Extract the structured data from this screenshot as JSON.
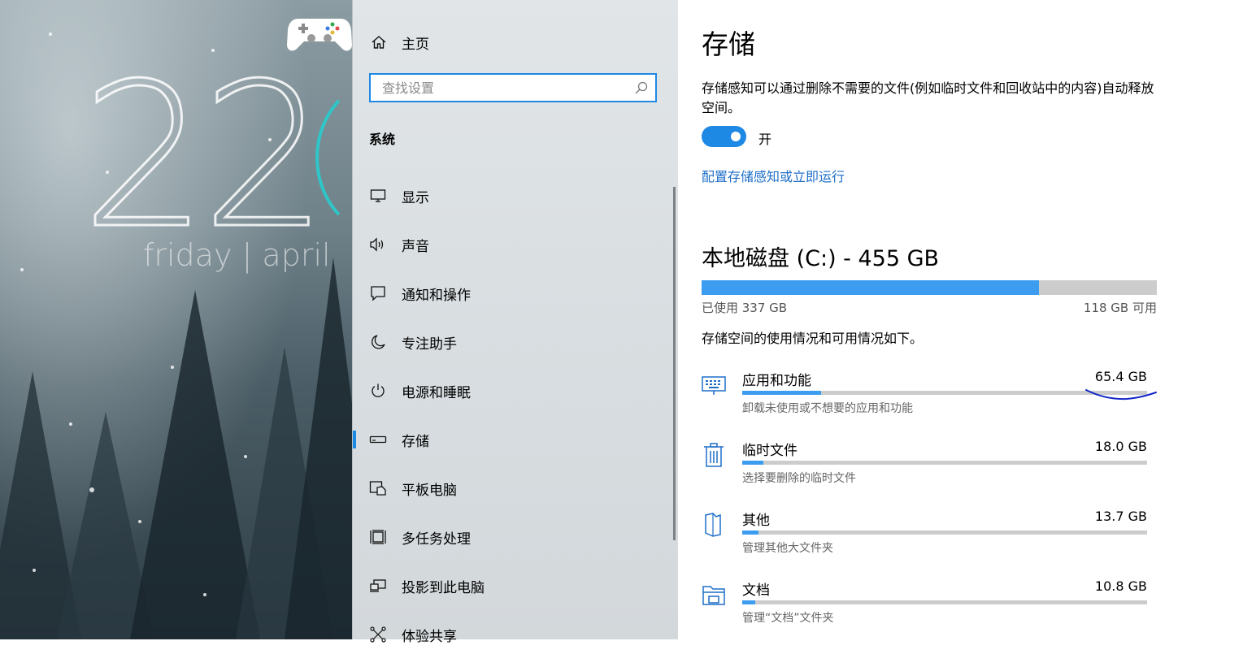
{
  "wallpaper": {
    "clock_digits": "22",
    "clock_date": "friday | april"
  },
  "nav": {
    "home_label": "主页",
    "search_placeholder": "查找设置",
    "section_title": "系统",
    "items": [
      {
        "label": "显示",
        "icon": "display-icon"
      },
      {
        "label": "声音",
        "icon": "speaker-icon"
      },
      {
        "label": "通知和操作",
        "icon": "notification-icon"
      },
      {
        "label": "专注助手",
        "icon": "moon-icon"
      },
      {
        "label": "电源和睡眠",
        "icon": "power-icon"
      },
      {
        "label": "存储",
        "icon": "storage-icon",
        "active": true
      },
      {
        "label": "平板电脑",
        "icon": "tablet-icon"
      },
      {
        "label": "多任务处理",
        "icon": "multitask-icon"
      },
      {
        "label": "投影到此电脑",
        "icon": "project-icon"
      },
      {
        "label": "体验共享",
        "icon": "share-icon"
      }
    ]
  },
  "main": {
    "title": "存储",
    "sense_description": "存储感知可以通过删除不需要的文件(例如临时文件和回收站中的内容)自动释放空间。",
    "toggle_state": "开",
    "config_link": "配置存储感知或立即运行",
    "disk_title": "本地磁盘 (C:) - 455 GB",
    "used_label": "已使用 337 GB",
    "free_label": "118 GB 可用",
    "used_fraction": 0.7407,
    "usage_description": "存储空间的使用情况和可用情况如下。",
    "categories": [
      {
        "name": "应用和功能",
        "size": "65.4 GB",
        "sub": "卸载未使用或不想要的应用和功能",
        "icon": "keyboard-icon",
        "fraction": 0.194
      },
      {
        "name": "临时文件",
        "size": "18.0 GB",
        "sub": "选择要删除的临时文件",
        "icon": "trash-icon",
        "fraction": 0.053
      },
      {
        "name": "其他",
        "size": "13.7 GB",
        "sub": "管理其他大文件夹",
        "icon": "file-icon",
        "fraction": 0.041
      },
      {
        "name": "文档",
        "size": "10.8 GB",
        "sub": "管理“文档”文件夹",
        "icon": "folder-icon",
        "fraction": 0.032
      }
    ]
  },
  "colors": {
    "accent": "#1e88e5",
    "bar_fill": "#3c9cf0",
    "bar_track": "#cccccc",
    "link": "#1e6ec8",
    "annotation": "#1428c8"
  }
}
